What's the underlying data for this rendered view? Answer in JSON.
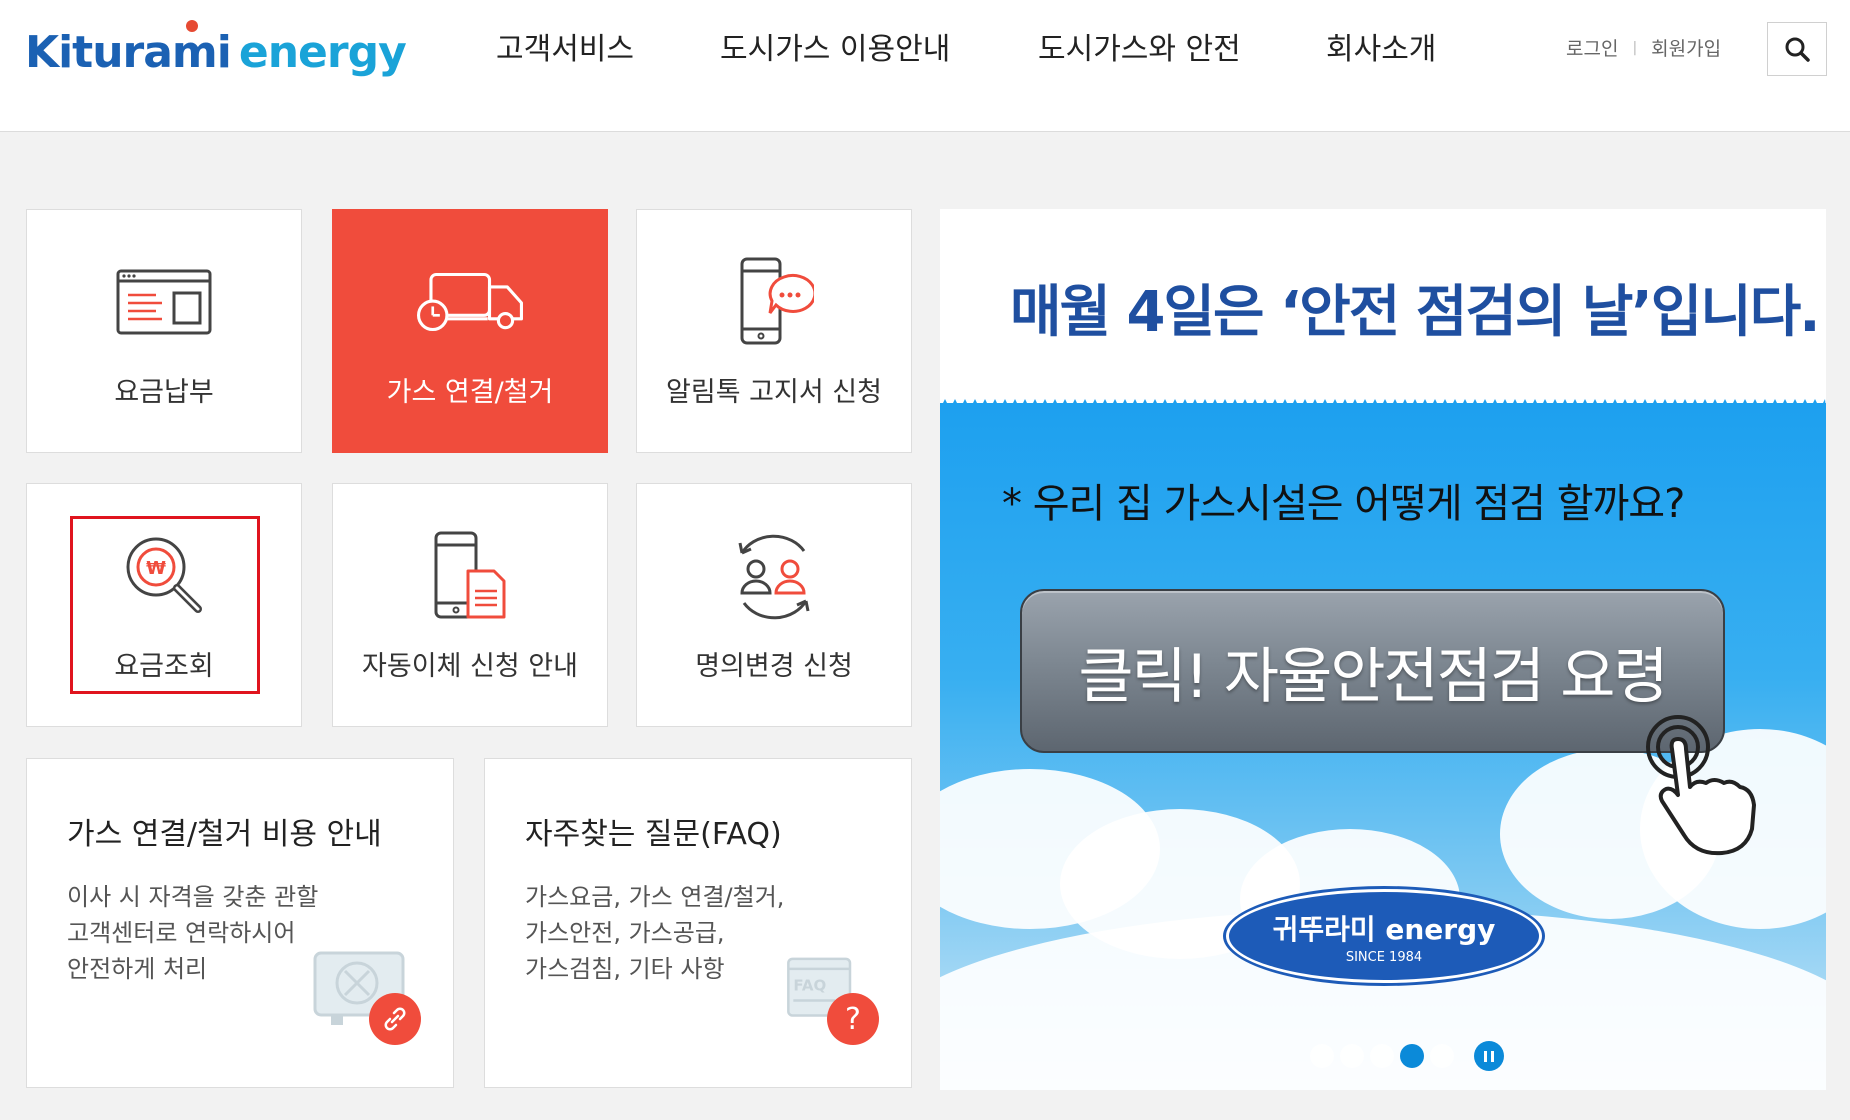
{
  "header": {
    "logo_part1": "Kiturami",
    "logo_part2": "energy",
    "nav": [
      {
        "label": "고객서비스"
      },
      {
        "label": "도시가스 이용안내"
      },
      {
        "label": "도시가스와 안전"
      },
      {
        "label": "회사소개"
      }
    ],
    "login": "로그인",
    "separator": "|",
    "signup": "회원가입"
  },
  "tiles": [
    {
      "label": "요금납부",
      "icon": "bill-window-icon"
    },
    {
      "label": "가스 연결/철거",
      "icon": "truck-clock-icon",
      "active": true
    },
    {
      "label": "알림톡 고지서 신청",
      "icon": "phone-chat-icon"
    },
    {
      "label": "요금조회",
      "icon": "won-magnifier-icon"
    },
    {
      "label": "자동이체 신청 안내",
      "icon": "phone-document-icon"
    },
    {
      "label": "명의변경 신청",
      "icon": "user-swap-icon"
    }
  ],
  "cards": [
    {
      "title": "가스 연결/철거 비용 안내",
      "lines": [
        "이사 시 자격을 갖춘 관할",
        "고객센터로 연락하시어",
        "안전하게 처리"
      ],
      "icon": "gas-meter-icon",
      "badge_icon": "link-icon"
    },
    {
      "title": "자주찾는 질문(FAQ)",
      "lines": [
        "가스요금, 가스 연결/철거,",
        "가스안전, 가스공급,",
        "가스검침, 기타 사항"
      ],
      "icon": "faq-window-icon",
      "badge": "?"
    }
  ],
  "banner": {
    "headline": "매월 4일은 ‘안전 점검의 날’입니다.",
    "question": "* 우리 집 가스시설은 어떻게 점검 할까요?",
    "button": "클릭! 자율안전점검 요령",
    "brand": "귀뚜라미 energy",
    "brand_since": "SINCE 1984",
    "slides_total": 5,
    "active_slide": 4
  },
  "colors": {
    "accent": "#f04c3c",
    "logo_blue": "#1b61b3",
    "logo_cyan": "#1aa3d8",
    "headline_blue": "#1f4fa0",
    "highlight": "#e0141e"
  }
}
